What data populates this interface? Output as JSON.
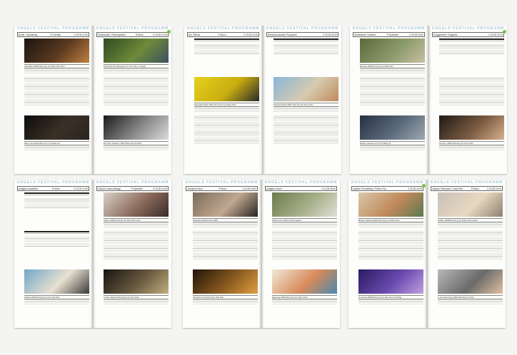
{
  "logo_text": "ENGELS FESTIVAL PROGRAMM",
  "accent_tab": "#7cc14b",
  "spreads": [
    {
      "name": "spread-1",
      "pages": [
        {
          "header_left": "Booth / Sportsmay",
          "header_mid": "R  Yverdan",
          "header_right": "II  23.05 12:00",
          "blocks": [
            {
              "kind": "image",
              "colors": [
                "#1a1410",
                "#5a3a20",
                "#c08040"
              ],
              "caption": "Ventrakol  2008  Running Ve Minn Film Film"
            },
            {
              "kind": "text"
            },
            {
              "kind": "image",
              "colors": [
                "#0c0c0c",
                "#3a3026",
                "#2a2420"
              ],
              "caption": "Moon  Vormark Mixe 21 min  Nebel lerr"
            }
          ]
        },
        {
          "header_left": "Ventrekdaln / Retrospektive",
          "header_mid": "R  Movo",
          "header_right": "II  23.05 14:00",
          "tab": true,
          "blocks": [
            {
              "kind": "image",
              "colors": [
                "#2f4a22",
                "#6f8a3a",
                "#3a5060"
              ],
              "caption": "Filmhaus Rio  Reseaum 10 min  Kino 1 Stage"
            },
            {
              "kind": "text"
            },
            {
              "kind": "image",
              "colors": [
                "#1a1a1a",
                "#8a8a8a",
                "#dcdcdc"
              ],
              "caption": "Doc film  Sweden  1964 Running Ve Spis"
            }
          ]
        }
      ]
    },
    {
      "name": "spread-2",
      "pages": [
        {
          "header_left": "Der Offener",
          "header_mid": "R  Movo",
          "header_right": "II  23.05 14:30",
          "blocks": [
            {
              "kind": "bars"
            },
            {
              "kind": "image",
              "colors": [
                "#e6d21c",
                "#c8ad10",
                "#2a2a2a"
              ],
              "caption": "Stendhal Rolle  2004  Running Ve Aberg Film"
            },
            {
              "kind": "text"
            }
          ]
        },
        {
          "header_left": "Rassismussanten Programm",
          "header_mid": "",
          "header_right": "II  23.05 20:00",
          "blocks": [
            {
              "kind": "bars"
            },
            {
              "kind": "image",
              "colors": [
                "#8ab6d8",
                "#d6cbb0",
                "#c08a5a"
              ],
              "caption": "Piranha Pferd  2007  Running Ve Sem Film"
            },
            {
              "kind": "text"
            }
          ]
        }
      ]
    },
    {
      "name": "spread-3",
      "pages": [
        {
          "header_left": "Nebelsteuer Vorlesen",
          "header_mid": "R  Sylvester",
          "header_right": "II  23.05 18:00",
          "blocks": [
            {
              "kind": "image",
              "colors": [
                "#5a6a3a",
                "#8a9a6a",
                "#c8c0a0"
              ],
              "caption": "Elusive  2008  Running Ve Wait Film"
            },
            {
              "kind": "text"
            },
            {
              "kind": "image",
              "colors": [
                "#283040",
                "#5a6a7a",
                "#a0a8b0"
              ],
              "caption": "Reflex  Quartet  10 min  Frühling 8"
            }
          ]
        },
        {
          "header_left": "Engagement / Engardis",
          "header_mid": "",
          "header_right": "II  23.05 21:00",
          "tab": true,
          "blocks": [
            {
              "kind": "bars"
            },
            {
              "kind": "text"
            },
            {
              "kind": "image",
              "colors": [
                "#1e1a16",
                "#7a5a40",
                "#d8b090"
              ],
              "caption": "Gemmy  2009  Running Ve Sem Film"
            }
          ]
        }
      ]
    },
    {
      "name": "spread-4",
      "pages": [
        {
          "header_left": "Aufgabe Ausstellen",
          "header_mid": "R  Movo",
          "header_right": "II  24.05 12:00",
          "blocks": [
            {
              "kind": "bars"
            },
            {
              "kind": "bars"
            },
            {
              "kind": "image",
              "colors": [
                "#70a8c8",
                "#e8e0d0",
                "#3a3a3a"
              ],
              "caption": "Fatalis  2009  Running Ve Freund Film"
            }
          ]
        },
        {
          "header_left": "Vuchan  Contructiktage",
          "header_mid": "R  Sylvester",
          "header_right": "II  24.05 14:00",
          "blocks": [
            {
              "kind": "image",
              "colors": [
                "#d8d0c8",
                "#8a6a5a",
                "#3a2a2a"
              ],
              "caption": "Steps  2009  Running Ve Wort Film Kino"
            },
            {
              "kind": "text"
            },
            {
              "kind": "image",
              "colors": [
                "#181410",
                "#6a5a40",
                "#c0b080"
              ],
              "caption": "Lichte  Hotel 24  Running Ve Sem Film"
            }
          ]
        }
      ]
    },
    {
      "name": "spread-5",
      "pages": [
        {
          "header_left": "Josephine Boor",
          "header_mid": "R  Movo",
          "header_right": "II  24.05 16:00",
          "blocks": [
            {
              "kind": "image",
              "colors": [
                "#7a6a5a",
                "#c0a890",
                "#2a2420"
              ],
              "caption": "Mandela Skiliensche  2009"
            },
            {
              "kind": "text"
            },
            {
              "kind": "image",
              "colors": [
                "#201408",
                "#8a5a20",
                "#e0a040"
              ],
              "caption": "Schierhar  Vorfunk 9min  Ahe Rat"
            }
          ]
        },
        {
          "header_left": "Aufgabe Keune",
          "header_mid": "",
          "header_right": "II  24.05 18:00",
          "blocks": [
            {
              "kind": "image",
              "colors": [
                "#6a7a4a",
                "#a8b08a",
                "#e0e0d8"
              ],
              "caption": "Rather  Anim Barn Kline  Spatal"
            },
            {
              "kind": "text"
            },
            {
              "kind": "image",
              "colors": [
                "#f0e8d8",
                "#d88a5a",
                "#4a8ab0"
              ],
              "caption": "Egentog  2006  Running Ve Alpen Film"
            }
          ]
        }
      ]
    },
    {
      "name": "spread-6",
      "pages": [
        {
          "header_left": "Jopliner Freundlichy / Fiction Fuk",
          "header_mid": "",
          "header_right": "II  24.05 20:00",
          "tab": true,
          "blocks": [
            {
              "kind": "image",
              "colors": [
                "#d8c8a8",
                "#c0885a",
                "#5a7a50"
              ],
              "caption": "Bruder  Stefani 2005 Running Ve Fahrt Film"
            },
            {
              "kind": "text"
            },
            {
              "kind": "image",
              "colors": [
                "#2a1a60",
                "#6a4ab0",
                "#c0a0e0"
              ],
              "caption": "Nemenia  2008  Running Ve Ade Film Frühling"
            }
          ]
        },
        {
          "header_left": "Jopliner Filmmoral / Kraut Rob",
          "header_mid": "R  Movo",
          "header_right": "II  24.05 22:00",
          "blocks": [
            {
              "kind": "image",
              "colors": [
                "#c8c0b8",
                "#e8d8c0",
                "#8a8070"
              ],
              "caption": "Gaben  2008  Running Ve Dram Film Glant"
            },
            {
              "kind": "text"
            },
            {
              "kind": "image",
              "colors": [
                "#b8b8b8",
                "#6a6a6a",
                "#e0c0a0"
              ],
              "caption": "F-Hu  Gamming  1960 Running Ve Film"
            }
          ]
        }
      ]
    }
  ]
}
